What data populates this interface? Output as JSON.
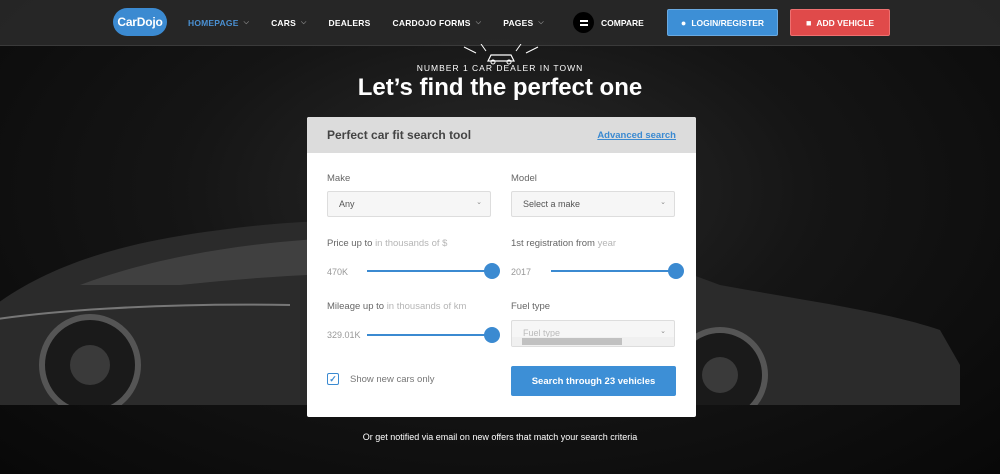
{
  "brand": {
    "logo_text": "CarDojo",
    "accent": "#3b8ad1",
    "danger": "#e04a4a"
  },
  "nav": {
    "items": [
      {
        "label": "HOMEPAGE",
        "dropdown": true,
        "active": true
      },
      {
        "label": "CARS",
        "dropdown": true,
        "active": false
      },
      {
        "label": "DEALERS",
        "dropdown": false,
        "active": false
      },
      {
        "label": "CARDOJO FORMS",
        "dropdown": true,
        "active": false
      },
      {
        "label": "PAGES",
        "dropdown": true,
        "active": false
      }
    ],
    "compare_label": "COMPARE",
    "login_label": "LOGIN/REGISTER",
    "add_vehicle_label": "ADD VEHICLE"
  },
  "hero": {
    "tagline": "NUMBER 1 CAR DEALER IN TOWN",
    "headline": "Let’s find the perfect one"
  },
  "search": {
    "title": "Perfect car fit search tool",
    "advanced_link": "Advanced search",
    "make": {
      "label": "Make",
      "value": "Any"
    },
    "model": {
      "label": "Model",
      "value": "Select a make"
    },
    "price": {
      "label": "Price up to",
      "hint": "in thousands of $",
      "value": "470K",
      "fill_percent": 100
    },
    "registration": {
      "label": "1st registration from",
      "hint": "year",
      "value": "2017",
      "fill_percent": 100
    },
    "mileage": {
      "label": "Mileage up to",
      "hint": "in thousands of km",
      "value": "329.01K",
      "fill_percent": 100
    },
    "fuel": {
      "label": "Fuel type",
      "placeholder": "Fuel type"
    },
    "new_only": {
      "label": "Show new cars only",
      "checked": true
    },
    "submit_label": "Search through 23 vehicles"
  },
  "footnote": "Or get notified via email on new offers that match your search criteria"
}
